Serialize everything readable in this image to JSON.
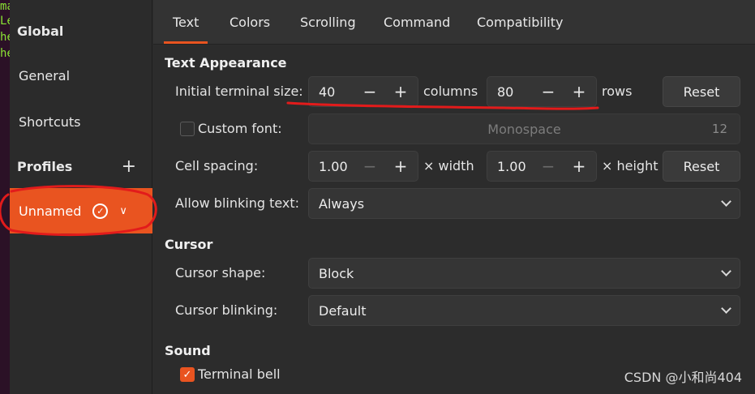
{
  "terminal_strip": {
    "lines": [
      "ma",
      "Le",
      "he",
      "he"
    ]
  },
  "sidebar": {
    "global_heading": "Global",
    "general": "General",
    "shortcuts": "Shortcuts",
    "profiles_heading": "Profiles",
    "add_profile_icon": "plus-icon",
    "profile": {
      "name": "Unnamed",
      "default_icon": "check-circle-icon",
      "menu_icon": "chevron-down-icon"
    }
  },
  "tabs": [
    "Text",
    "Colors",
    "Scrolling",
    "Command",
    "Compatibility"
  ],
  "active_tab": "Text",
  "text_appearance": {
    "heading": "Text Appearance",
    "initial_size_label": "Initial terminal size:",
    "columns_value": "40",
    "columns_unit": "columns",
    "rows_value": "80",
    "rows_unit": "rows",
    "minus": "−",
    "plus": "+",
    "reset_label": "Reset",
    "custom_font_label": "Custom font:",
    "custom_font_checked": false,
    "font_name": "Monospace",
    "font_size": "12",
    "cell_spacing_label": "Cell spacing:",
    "width_value": "1.00",
    "width_unit": "× width",
    "height_value": "1.00",
    "height_unit": "× height",
    "blink_label": "Allow blinking text:",
    "blink_value": "Always"
  },
  "cursor": {
    "heading": "Cursor",
    "shape_label": "Cursor shape:",
    "shape_value": "Block",
    "blinking_label": "Cursor blinking:",
    "blinking_value": "Default"
  },
  "sound": {
    "heading": "Sound",
    "bell_label": "Terminal bell",
    "bell_checked": true
  },
  "watermark": "CSDN @小和尚404",
  "colors": {
    "accent": "#e95420",
    "annotation_red": "#e21b1b"
  }
}
